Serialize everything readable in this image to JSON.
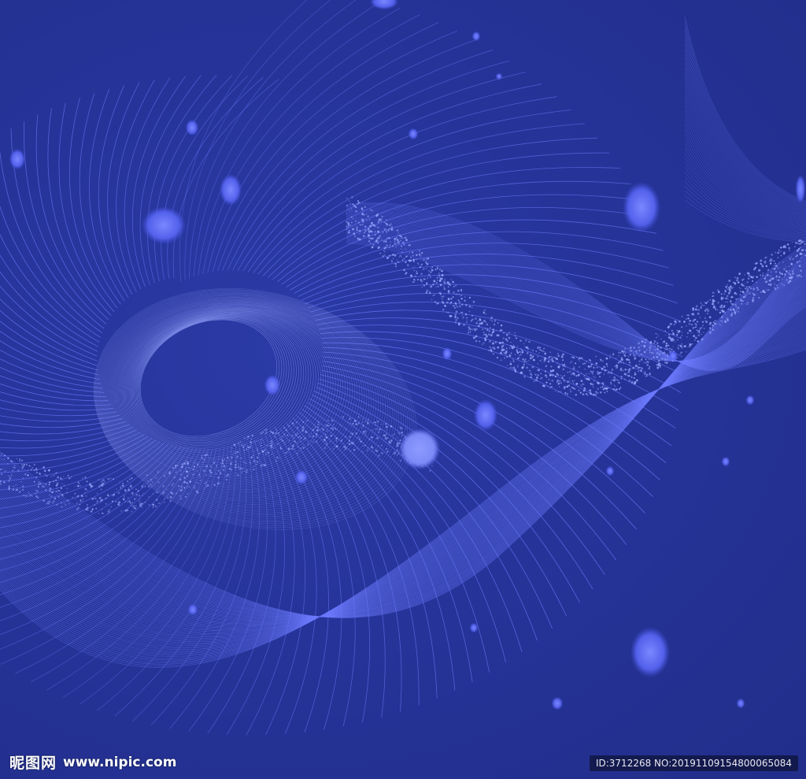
{
  "image": {
    "description_colors": {
      "background": "#24318f",
      "line": "#6f7dff",
      "particle": "#5b6bff",
      "highlight": "#9aa6ff"
    }
  },
  "watermark": {
    "site_cn": "昵图网",
    "site_url": "www.nipic.com",
    "id_text": "ID:3712268 NO:20191109154800065084"
  }
}
